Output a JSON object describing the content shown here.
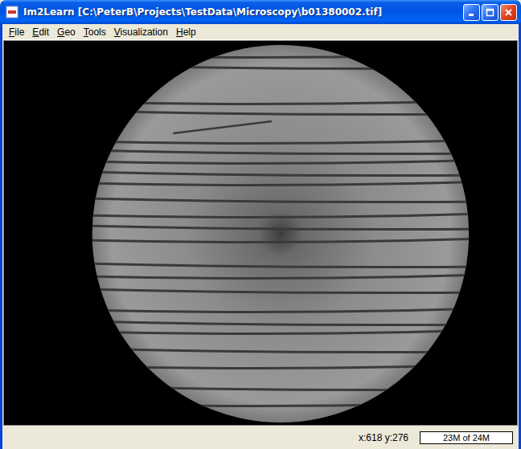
{
  "window": {
    "title": "Im2Learn [C:\\PeterB\\Projects\\TestData\\Microscopy\\b01380002.tif]"
  },
  "menu": [
    {
      "label": "File"
    },
    {
      "label": "Edit"
    },
    {
      "label": "Geo"
    },
    {
      "label": "Tools"
    },
    {
      "label": "Visualization"
    },
    {
      "label": "Help"
    }
  ],
  "status_bar": {
    "coordinates": "x:618 y:276",
    "memory": "23M of 24M"
  }
}
